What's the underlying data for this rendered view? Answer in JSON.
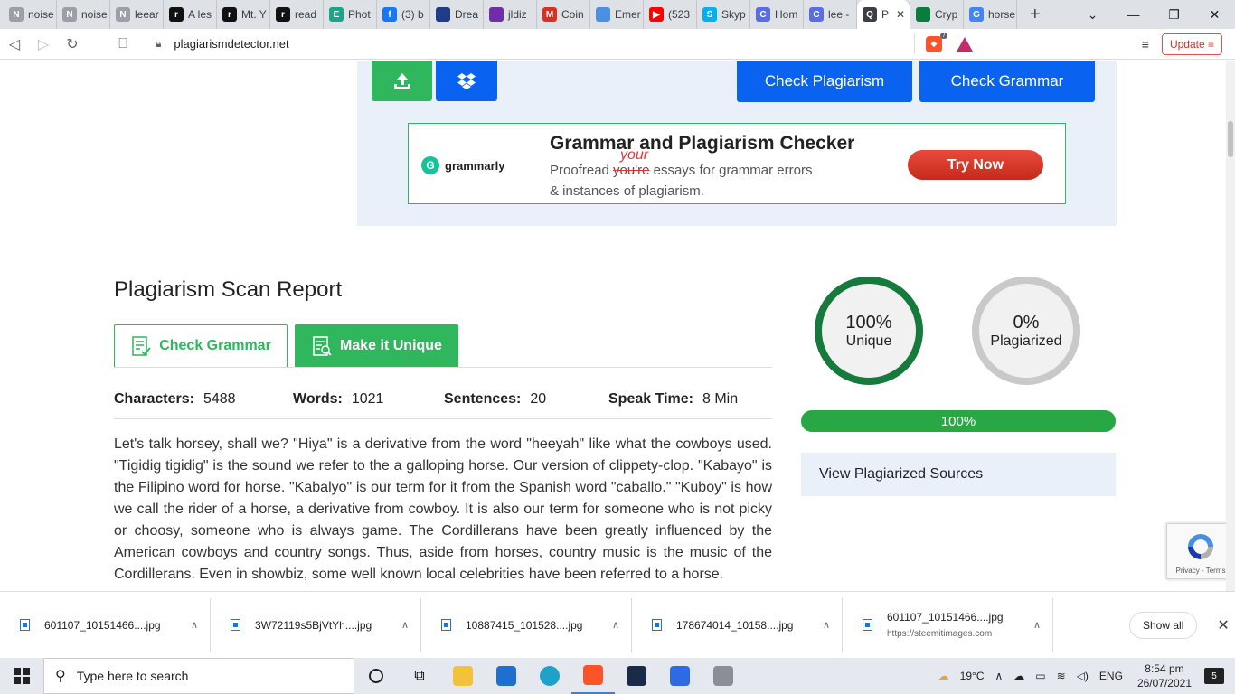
{
  "browser": {
    "tabs": [
      {
        "label": "noise",
        "fav_text": "N",
        "fav_color": "#9aa0a6"
      },
      {
        "label": "noise",
        "fav_text": "N",
        "fav_color": "#9aa0a6"
      },
      {
        "label": "leear",
        "fav_text": "N",
        "fav_color": "#9aa0a6"
      },
      {
        "label": "A les",
        "fav_text": "r",
        "fav_color": "#111111"
      },
      {
        "label": "Mt. Y",
        "fav_text": "r",
        "fav_color": "#111111"
      },
      {
        "label": "read",
        "fav_text": "r",
        "fav_color": "#111111"
      },
      {
        "label": "Phot",
        "fav_text": "E",
        "fav_color": "#18a689"
      },
      {
        "label": "(3) b",
        "fav_text": "f",
        "fav_color": "#1877f2"
      },
      {
        "label": "Drea",
        "fav_text": "",
        "fav_color": "#1f3c88"
      },
      {
        "label": "jldiz",
        "fav_text": "",
        "fav_color": "#6f2da8"
      },
      {
        "label": "Coin",
        "fav_text": "M",
        "fav_color": "#d93025"
      },
      {
        "label": "Emer",
        "fav_text": "",
        "fav_color": "#4a90e2"
      },
      {
        "label": "(523",
        "fav_text": "▶",
        "fav_color": "#ff0000"
      },
      {
        "label": "Skyp",
        "fav_text": "S",
        "fav_color": "#00aff0"
      },
      {
        "label": "Hom",
        "fav_text": "C",
        "fav_color": "#5b6ee1"
      },
      {
        "label": "lee -",
        "fav_text": "C",
        "fav_color": "#5b6ee1"
      },
      {
        "label": "P",
        "fav_text": "Q",
        "fav_color": "#3c4043",
        "active": true
      },
      {
        "label": "Cryp",
        "fav_text": "",
        "fav_color": "#0a7d3e"
      },
      {
        "label": "horse",
        "fav_text": "G",
        "fav_color": "#4285f4"
      }
    ],
    "new_tab": "+",
    "url": "plagiarismdetector.net",
    "brave_badge": "7",
    "update_label": "Update"
  },
  "page": {
    "top_buttons": {
      "check_plagiarism": "Check Plagiarism",
      "check_grammar": "Check Grammar"
    },
    "ad": {
      "brand": "grammarly",
      "title": "Grammar and Plagiarism Checker",
      "line1_prefix": "Proofread ",
      "struck_word": "you're",
      "correction": "your",
      "line1_suffix": " essays for grammar errors",
      "line2": "& instances of plagiarism.",
      "cta": "Try Now"
    },
    "report": {
      "title": "Plagiarism Scan Report",
      "btn_check_grammar": "Check Grammar",
      "btn_make_unique": "Make it Unique",
      "stats": [
        {
          "label": "Characters:",
          "value": "5488"
        },
        {
          "label": "Words:",
          "value": "1021"
        },
        {
          "label": "Sentences:",
          "value": "20"
        },
        {
          "label": "Speak Time:",
          "value": "8 Min"
        }
      ],
      "body": "Let's talk horsey, shall we? \"Hiya\" is a derivative from the word \"heeyah\" like what the cowboys used. \"Tigidig tigidig\" is the sound we refer to the a galloping horse. Our version of clippety-clop. \"Kabayo\" is the Filipino word for horse. \"Kabalyo\" is our term for it from the Spanish word \"caballo.\" \"Kuboy\" is how we call the rider of a horse, a derivative from cowboy. It is also our term for someone who is not picky or choosy, someone who is always game. The Cordillerans have been greatly influenced by the American cowboys and country songs. Thus, aside from horses, country music is the music of the Cordillerans. Even in showbiz, some well known local celebrities have been referred to a horse."
    },
    "result": {
      "unique_pct": "100%",
      "unique_label": "Unique",
      "plag_pct": "0%",
      "plag_label": "Plagiarized",
      "progress_value": 100,
      "progress_label": "100%",
      "view_sources": "View Plagiarized Sources"
    },
    "recaptcha": "Privacy - Terms"
  },
  "downloads": {
    "items": [
      {
        "name": "601107_10151466....jpg",
        "sub": ""
      },
      {
        "name": "3W72119s5BjVtYh....jpg",
        "sub": ""
      },
      {
        "name": "10887415_101528....jpg",
        "sub": ""
      },
      {
        "name": "178674014_10158....jpg",
        "sub": ""
      },
      {
        "name": "601107_10151466....jpg",
        "sub": "https://steemitimages.com"
      }
    ],
    "show_all": "Show all"
  },
  "taskbar": {
    "search_placeholder": "Type here to search",
    "weather": "19°C",
    "lang": "ENG",
    "time": "8:54 pm",
    "date": "26/07/2021",
    "notifications": "5"
  }
}
